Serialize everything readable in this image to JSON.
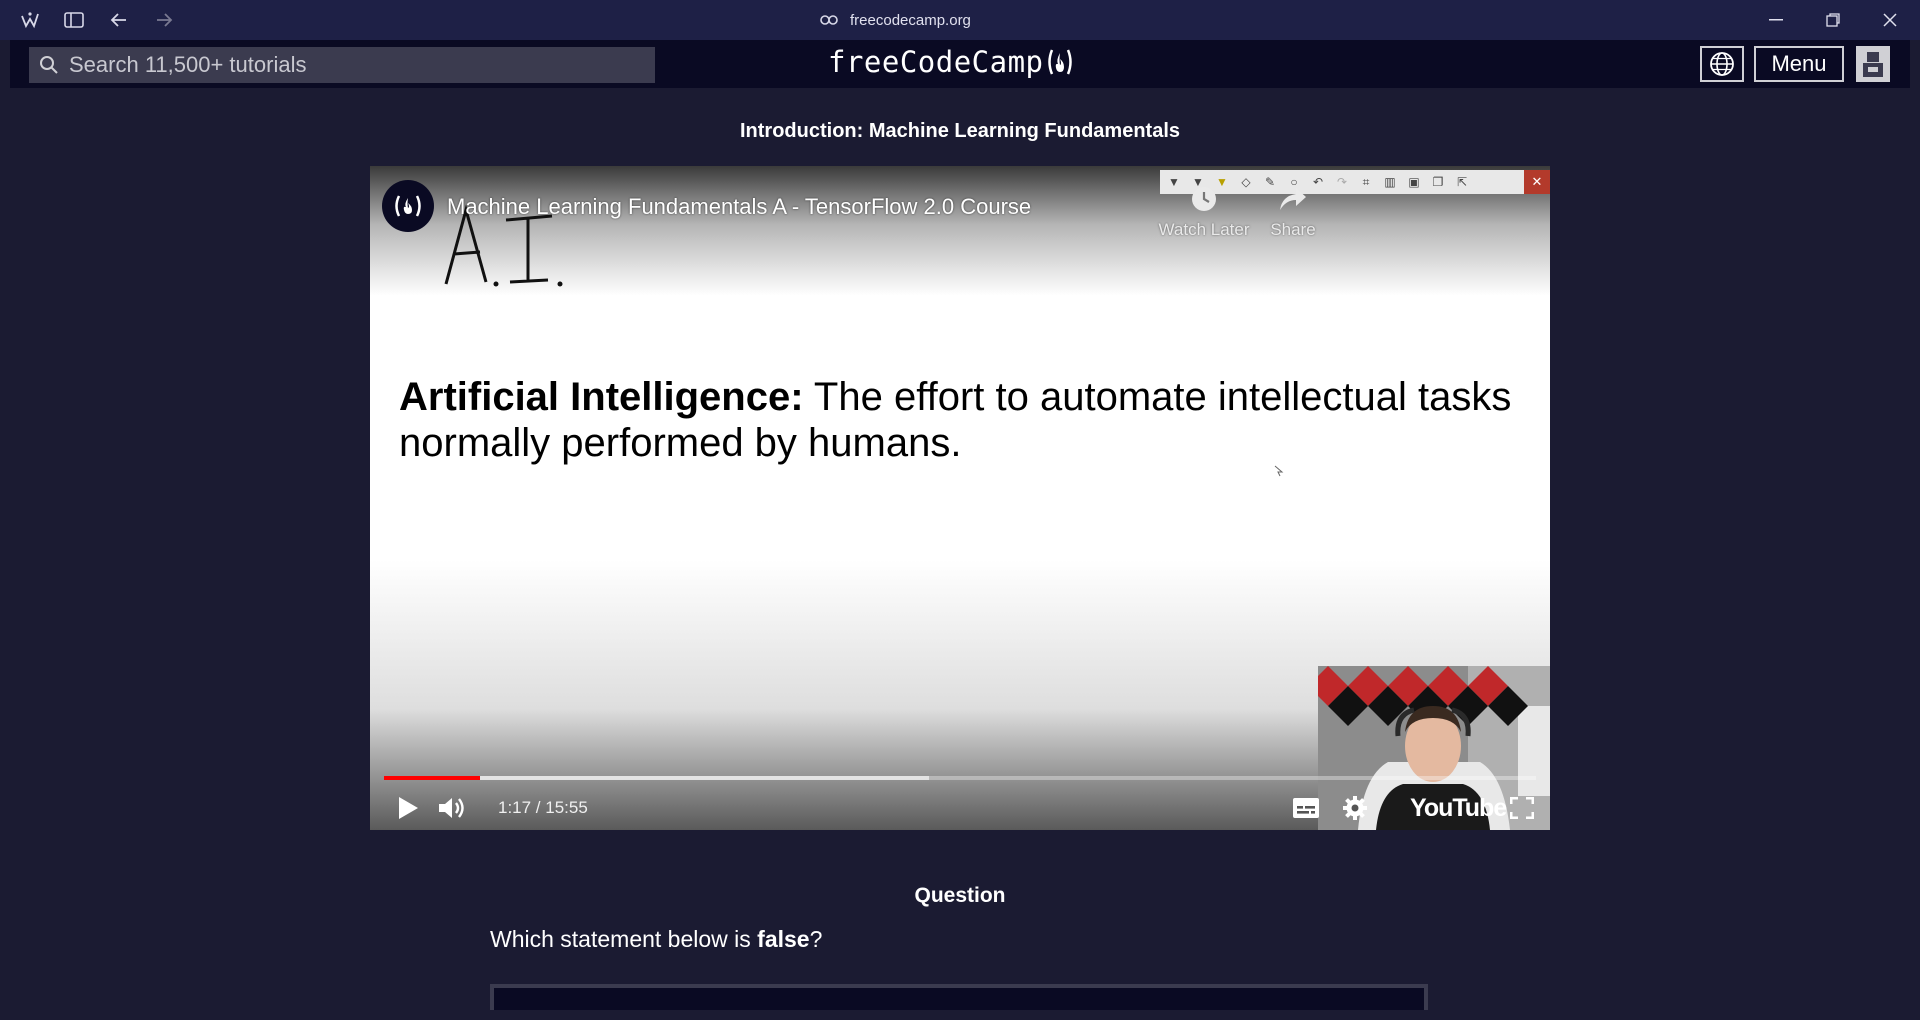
{
  "browser": {
    "url": "freecodecamp.org"
  },
  "header": {
    "search_placeholder": "Search 11,500+ tutorials",
    "logo_text": "freeCodeCamp",
    "menu_label": "Menu"
  },
  "lesson": {
    "title": "Introduction: Machine Learning Fundamentals"
  },
  "video": {
    "title": "Machine Learning Fundamentals A - TensorFlow 2.0 Course",
    "handwriting": "A.I.",
    "slide_bold": "Artificial Intelligence:",
    "slide_rest": " The effort to automate intellectual tasks normally performed by humans.",
    "watch_later_label": "Watch Later",
    "share_label": "Share",
    "time": "1:17 / 15:55",
    "played_fraction": 0.083,
    "buffered_fraction": 0.473,
    "youtube_label": "YouTube",
    "progress_color": "#ff0000"
  },
  "question": {
    "heading": "Question",
    "prefix": "Which statement below is ",
    "emphasis": "false",
    "suffix": "?"
  },
  "colors": {
    "page_bg": "#1b1b32",
    "header_bg": "#0a0a23",
    "chrome_bg": "#1e2046"
  }
}
